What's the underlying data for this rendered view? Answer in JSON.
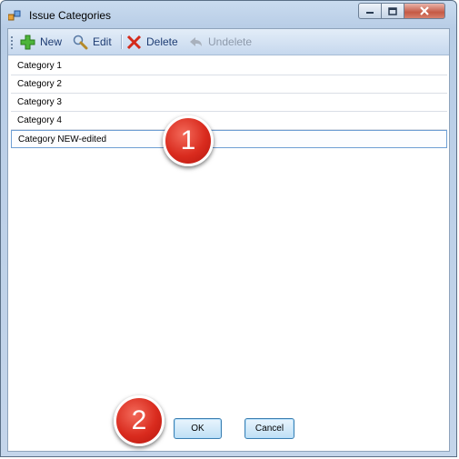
{
  "window": {
    "title": "Issue Categories",
    "controls": [
      "minimize-icon",
      "maximize-icon",
      "close-icon"
    ]
  },
  "toolbar": {
    "new_label": "New",
    "edit_label": "Edit",
    "delete_label": "Delete",
    "undelete_label": "Undelete"
  },
  "categories": [
    "Category 1",
    "Category 2",
    "Category 3",
    "Category 4",
    "Category NEW-edited"
  ],
  "buttons": {
    "ok_label": "OK",
    "cancel_label": "Cancel"
  },
  "annotations": {
    "badge_1": "1",
    "badge_2": "2"
  },
  "colors": {
    "toolbar_text": "#1d3c73",
    "badge_red": "#d92b1e"
  }
}
